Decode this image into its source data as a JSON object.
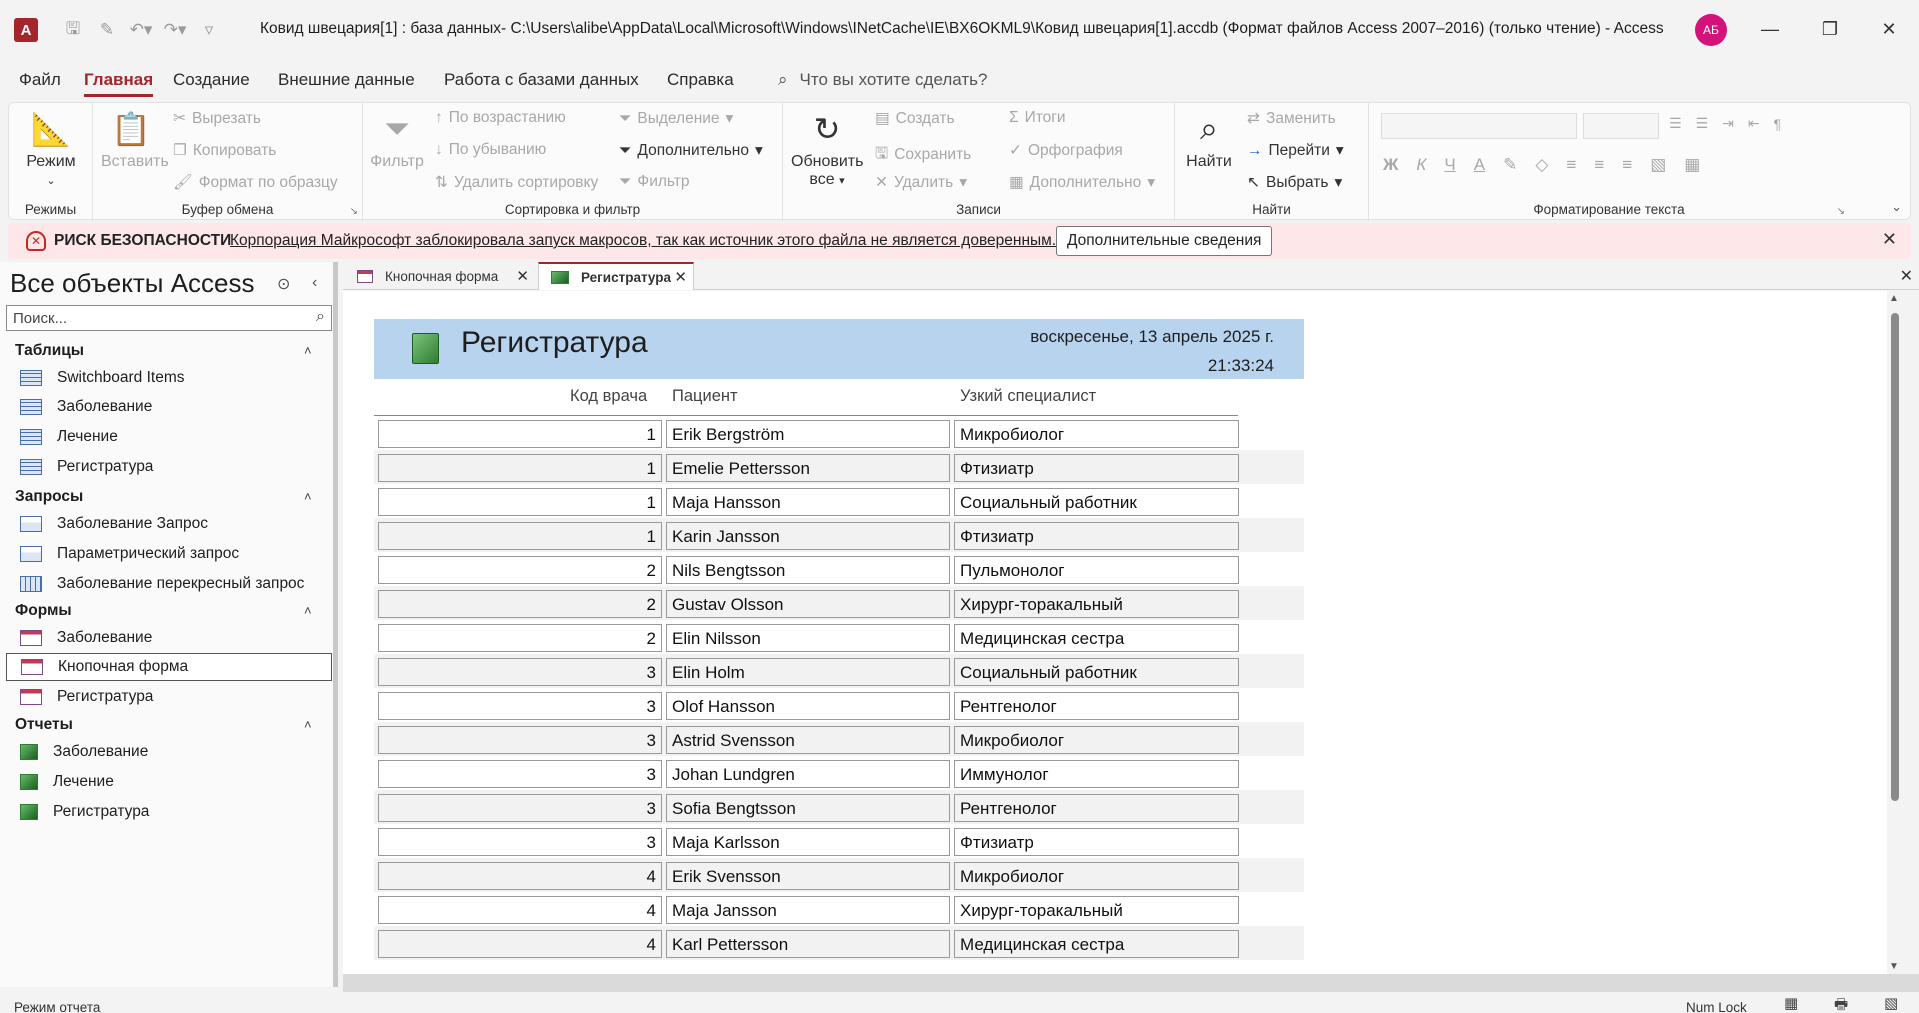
{
  "window": {
    "app_logo": "A",
    "title": "Ковид швецария[1] : база данных- C:\\Users\\alibe\\AppData\\Local\\Microsoft\\Windows\\INetCache\\IE\\BX6OKML9\\Ковид швецария[1].accdb (Формат файлов Access 2007–2016) (только чтение)  -  Access",
    "user_initials": "АБ"
  },
  "menu": {
    "tabs": [
      "Файл",
      "Главная",
      "Создание",
      "Внешние данные",
      "Работа с базами данных",
      "Справка"
    ],
    "active": "Главная",
    "tell_me": "Что вы хотите сделать?"
  },
  "ribbon": {
    "views": {
      "mode": "Режим",
      "group": "Режимы"
    },
    "clipboard": {
      "paste": "Вставить",
      "cut": "Вырезать",
      "copy": "Копировать",
      "format_painter": "Формат по образцу",
      "group": "Буфер обмена"
    },
    "sort_filter": {
      "filter": "Фильтр",
      "ascending": "По возрастанию",
      "descending": "По убыванию",
      "remove_sort": "Удалить сортировку",
      "selection": "Выделение",
      "advanced": "Дополнительно",
      "toggle_filter": "Фильтр",
      "group": "Сортировка и фильтр"
    },
    "records": {
      "refresh": "Обновить",
      "refresh_all": "все",
      "new": "Создать",
      "save": "Сохранить",
      "delete": "Удалить",
      "totals": "Итоги",
      "spelling": "Орфография",
      "more": "Дополнительно",
      "group": "Записи"
    },
    "find": {
      "find": "Найти",
      "replace": "Заменить",
      "goto": "Перейти",
      "select": "Выбрать",
      "group": "Найти"
    },
    "text_format": {
      "bold": "Ж",
      "italic": "К",
      "underline": "Ч",
      "font_color": "A",
      "group": "Форматирование текста"
    }
  },
  "security": {
    "title": "РИСК БЕЗОПАСНОСТИ",
    "message": "Корпорация Майкрософт заблокировала запуск макросов, так как источник этого файла не является доверенным.",
    "button": "Дополнительные сведения"
  },
  "nav": {
    "title": "Все объекты Access",
    "search_placeholder": "Поиск...",
    "sections": [
      {
        "name": "Таблицы",
        "items": [
          "Switchboard Items",
          "Заболевание",
          "Лечение",
          "Регистратура"
        ]
      },
      {
        "name": "Запросы",
        "items": [
          "Заболевание Запрос",
          "Параметрический запрос",
          "Заболевание перекресный запрос"
        ]
      },
      {
        "name": "Формы",
        "items": [
          "Заболевание",
          "Кнопочная форма",
          "Регистратура"
        ]
      },
      {
        "name": "Отчеты",
        "items": [
          "Заболевание",
          "Лечение",
          "Регистратура"
        ]
      }
    ],
    "selected_item": "Кнопочная форма"
  },
  "doc_tabs": [
    "Кнопочная форма",
    "Регистратура"
  ],
  "active_doc_tab": "Регистратура",
  "report": {
    "title": "Регистратура",
    "date": "воскресенье, 13 апрель 2025 г.",
    "time": "21:33:24",
    "columns": [
      "Код врача",
      "Пациент",
      "Узкий специалист"
    ],
    "rows": [
      [
        "1",
        "Erik Bergström",
        "Микробиолог"
      ],
      [
        "1",
        "Emelie Pettersson",
        "Фтизиатр"
      ],
      [
        "1",
        "Maja Hansson",
        "Социальный работник"
      ],
      [
        "1",
        "Karin Jansson",
        "Фтизиатр"
      ],
      [
        "2",
        "Nils Bengtsson",
        "Пульмонолог"
      ],
      [
        "2",
        "Gustav Olsson",
        "Хирург-торакальный"
      ],
      [
        "2",
        "Elin Nilsson",
        "Медицинская сестра"
      ],
      [
        "3",
        "Elin Holm",
        "Социальный работник"
      ],
      [
        "3",
        "Olof Hansson",
        "Рентгенолог"
      ],
      [
        "3",
        "Astrid Svensson",
        "Микробиолог"
      ],
      [
        "3",
        "Johan Lundgren",
        "Иммунолог"
      ],
      [
        "3",
        "Sofia Bengtsson",
        "Рентгенолог"
      ],
      [
        "3",
        "Maja Karlsson",
        "Фтизиатр"
      ],
      [
        "4",
        "Erik Svensson",
        "Микробиолог"
      ],
      [
        "4",
        "Maja Jansson",
        "Хирург-торакальный"
      ],
      [
        "4",
        "Karl Pettersson",
        "Медицинская сестра"
      ]
    ]
  },
  "status": {
    "left": "Режим отчета",
    "num_lock": "Num Lock"
  }
}
